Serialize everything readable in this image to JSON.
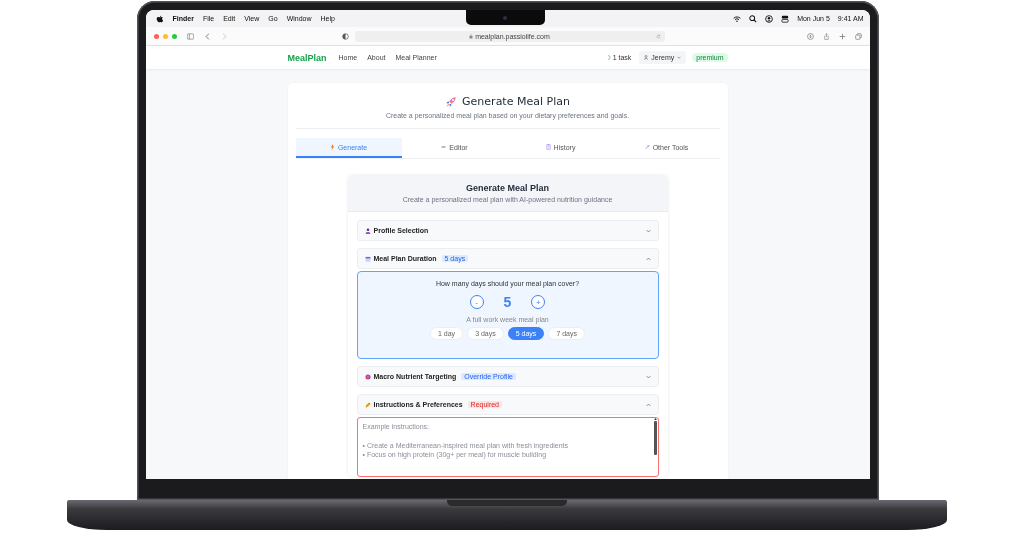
{
  "menubar": {
    "app": "Finder",
    "menus": [
      "File",
      "Edit",
      "View",
      "Go",
      "Window",
      "Help"
    ],
    "date": "Mon Jun 5",
    "time": "9:41 AM"
  },
  "browser": {
    "url": "mealplan.passiolife.com"
  },
  "nav": {
    "logo": "MealPlan",
    "links": [
      "Home",
      "About",
      "Meal Planner"
    ],
    "task": "1 task",
    "user": "Jeremy",
    "badge": "premium"
  },
  "page": {
    "title": "Generate Meal Plan",
    "subtitle": "Create a personalized meal plan based on your dietary preferences and goals.",
    "tabs": [
      {
        "label": "Generate",
        "kind": "bolt",
        "selected": true
      },
      {
        "label": "Editor",
        "kind": "pencil",
        "selected": false
      },
      {
        "label": "History",
        "kind": "clipboard",
        "selected": false
      },
      {
        "label": "Other Tools",
        "kind": "tools",
        "selected": false
      }
    ]
  },
  "panel": {
    "title": "Generate Meal Plan",
    "subtitle": "Create a personalized meal plan with AI-powered nutrition guidance",
    "sections": [
      {
        "kind": "profile",
        "title": "Profile Selection",
        "expanded": false
      },
      {
        "kind": "duration",
        "title": "Meal Plan Duration",
        "badge": {
          "text": "5 days",
          "kind": "info"
        },
        "expanded": true
      },
      {
        "kind": "macros",
        "title": "Macro Nutrient Targeting",
        "badge": {
          "text": "Override Profile",
          "kind": "info"
        },
        "expanded": false
      },
      {
        "kind": "instructions",
        "title": "Instructions & Preferences",
        "badge": {
          "text": "Required",
          "kind": "required"
        },
        "expanded": true
      }
    ],
    "duration": {
      "question": "How many days should your meal plan cover?",
      "minus": "-",
      "value": "5",
      "plus": "+",
      "caption": "A full work week meal plan",
      "options": [
        {
          "label": "1 day",
          "selected": false
        },
        {
          "label": "3 days",
          "selected": false
        },
        {
          "label": "5 days",
          "selected": true
        },
        {
          "label": "7 days",
          "selected": false
        }
      ]
    },
    "instructions": {
      "placeholder": "Example instructions:\n\n• Create a Mediterranean-inspired meal plan with fresh ingredients\n• Focus on high protein (30g+ per meal) for muscle building"
    }
  }
}
